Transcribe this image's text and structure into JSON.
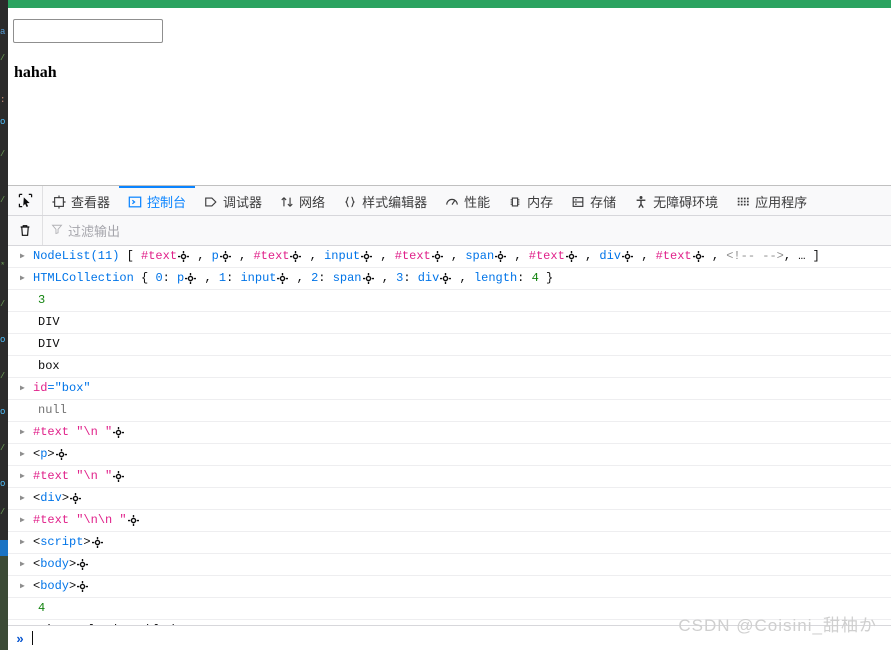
{
  "colors": {
    "accent": "#0a84ff",
    "green_bar": "#2ba360",
    "tag_blue": "#0074e8",
    "text_pink": "#e0218a",
    "number_green": "#12830f",
    "null_grey": "#737373",
    "watermark": "#cfcfcf"
  },
  "page": {
    "input_value": "",
    "input_placeholder": "",
    "body_text": "hahah"
  },
  "devtools": {
    "picker_icon": "element-picker-icon",
    "tabs": [
      {
        "label": "查看器",
        "icon": "inspector-icon",
        "active": false
      },
      {
        "label": "控制台",
        "icon": "console-icon",
        "active": true
      },
      {
        "label": "调试器",
        "icon": "debugger-icon",
        "active": false
      },
      {
        "label": "网络",
        "icon": "network-icon",
        "active": false
      },
      {
        "label": "样式编辑器",
        "icon": "style-editor-icon",
        "active": false
      },
      {
        "label": "性能",
        "icon": "performance-icon",
        "active": false
      },
      {
        "label": "内存",
        "icon": "memory-icon",
        "active": false
      },
      {
        "label": "存储",
        "icon": "storage-icon",
        "active": false
      },
      {
        "label": "无障碍环境",
        "icon": "accessibility-icon",
        "active": false
      },
      {
        "label": "应用程序",
        "icon": "application-icon",
        "active": false
      }
    ],
    "filter_bar": {
      "trash_icon": "trash-icon",
      "filter_icon": "funnel-icon",
      "placeholder": "过滤输出",
      "value": ""
    },
    "prompt": {
      "chevron": "»",
      "value": ""
    }
  },
  "console_rows": [
    {
      "id": "nodelist-row",
      "twisty": true,
      "segments": [
        {
          "t": "NodeList(11) ",
          "c": "k-blue"
        },
        {
          "t": "[ ",
          "c": "k-dark"
        },
        {
          "t": "#text",
          "c": "k-pink"
        },
        {
          "t": "crosshair",
          "c": "icon"
        },
        {
          "t": " , ",
          "c": "k-dark"
        },
        {
          "t": "p",
          "c": "k-blue"
        },
        {
          "t": "crosshair",
          "c": "icon"
        },
        {
          "t": " , ",
          "c": "k-dark"
        },
        {
          "t": "#text",
          "c": "k-pink"
        },
        {
          "t": "crosshair",
          "c": "icon"
        },
        {
          "t": " , ",
          "c": "k-dark"
        },
        {
          "t": "input",
          "c": "k-blue"
        },
        {
          "t": "crosshair",
          "c": "icon"
        },
        {
          "t": " , ",
          "c": "k-dark"
        },
        {
          "t": "#text",
          "c": "k-pink"
        },
        {
          "t": "crosshair",
          "c": "icon"
        },
        {
          "t": " , ",
          "c": "k-dark"
        },
        {
          "t": "span",
          "c": "k-blue"
        },
        {
          "t": "crosshair",
          "c": "icon"
        },
        {
          "t": " , ",
          "c": "k-dark"
        },
        {
          "t": "#text",
          "c": "k-pink"
        },
        {
          "t": "crosshair",
          "c": "icon"
        },
        {
          "t": " , ",
          "c": "k-dark"
        },
        {
          "t": "div",
          "c": "k-blue"
        },
        {
          "t": "crosshair",
          "c": "icon"
        },
        {
          "t": " , ",
          "c": "k-dark"
        },
        {
          "t": "#text",
          "c": "k-pink"
        },
        {
          "t": "crosshair",
          "c": "icon"
        },
        {
          "t": " , ",
          "c": "k-dark"
        },
        {
          "t": "<!--    -->",
          "c": "k-comment"
        },
        {
          "t": ", … ]",
          "c": "k-dark"
        }
      ]
    },
    {
      "id": "htmlcollection-row",
      "twisty": true,
      "segments": [
        {
          "t": "HTMLCollection ",
          "c": "k-blue"
        },
        {
          "t": "{ ",
          "c": "k-dark"
        },
        {
          "t": "0",
          "c": "k-blue"
        },
        {
          "t": ": ",
          "c": "k-dark"
        },
        {
          "t": "p",
          "c": "k-blue"
        },
        {
          "t": "crosshair",
          "c": "icon"
        },
        {
          "t": " , ",
          "c": "k-dark"
        },
        {
          "t": "1",
          "c": "k-blue"
        },
        {
          "t": ": ",
          "c": "k-dark"
        },
        {
          "t": "input",
          "c": "k-blue"
        },
        {
          "t": "crosshair",
          "c": "icon"
        },
        {
          "t": " , ",
          "c": "k-dark"
        },
        {
          "t": "2",
          "c": "k-blue"
        },
        {
          "t": ": ",
          "c": "k-dark"
        },
        {
          "t": "span",
          "c": "k-blue"
        },
        {
          "t": "crosshair",
          "c": "icon"
        },
        {
          "t": " , ",
          "c": "k-dark"
        },
        {
          "t": "3",
          "c": "k-blue"
        },
        {
          "t": ": ",
          "c": "k-dark"
        },
        {
          "t": "div",
          "c": "k-blue"
        },
        {
          "t": "crosshair",
          "c": "icon"
        },
        {
          "t": " , ",
          "c": "k-dark"
        },
        {
          "t": "length",
          "c": "k-blue"
        },
        {
          "t": ": ",
          "c": "k-dark"
        },
        {
          "t": "4",
          "c": "k-green"
        },
        {
          "t": " }",
          "c": "k-dark"
        }
      ]
    },
    {
      "id": "num-3-row",
      "twisty": false,
      "segments": [
        {
          "t": "3",
          "c": "k-green"
        }
      ]
    },
    {
      "id": "div-1-row",
      "twisty": false,
      "segments": [
        {
          "t": "DIV",
          "c": "k-dark"
        }
      ]
    },
    {
      "id": "div-2-row",
      "twisty": false,
      "segments": [
        {
          "t": "DIV",
          "c": "k-dark"
        }
      ]
    },
    {
      "id": "box-row",
      "twisty": false,
      "segments": [
        {
          "t": "box",
          "c": "k-dark"
        }
      ]
    },
    {
      "id": "idbox-row",
      "twisty": true,
      "segments": [
        {
          "t": "id",
          "c": "k-pink"
        },
        {
          "t": "=\"box\"",
          "c": "k-blue"
        }
      ]
    },
    {
      "id": "null-row",
      "twisty": false,
      "segments": [
        {
          "t": "null",
          "c": "k-grey"
        }
      ]
    },
    {
      "id": "text-node-1-row",
      "twisty": true,
      "segments": [
        {
          "t": "#text",
          "c": "k-pink"
        },
        {
          "t": " \"\\n           \"",
          "c": "k-pink"
        },
        {
          "t": "crosshair",
          "c": "icon"
        }
      ]
    },
    {
      "id": "p-node-row",
      "twisty": true,
      "segments": [
        {
          "t": "<",
          "c": "k-dark"
        },
        {
          "t": "p",
          "c": "k-blue"
        },
        {
          "t": ">",
          "c": "k-dark"
        },
        {
          "t": "crosshair",
          "c": "icon"
        }
      ]
    },
    {
      "id": "text-node-2-row",
      "twisty": true,
      "segments": [
        {
          "t": "#text",
          "c": "k-pink"
        },
        {
          "t": " \"\\n     \"",
          "c": "k-pink"
        },
        {
          "t": "crosshair",
          "c": "icon"
        }
      ]
    },
    {
      "id": "div-node-row",
      "twisty": true,
      "segments": [
        {
          "t": "<",
          "c": "k-dark"
        },
        {
          "t": "div",
          "c": "k-blue"
        },
        {
          "t": ">",
          "c": "k-dark"
        },
        {
          "t": "crosshair",
          "c": "icon"
        }
      ]
    },
    {
      "id": "text-node-3-row",
      "twisty": true,
      "segments": [
        {
          "t": "#text",
          "c": "k-pink"
        },
        {
          "t": " \"\\n\\n     \"",
          "c": "k-pink"
        },
        {
          "t": "crosshair",
          "c": "icon"
        }
      ]
    },
    {
      "id": "script-node-row",
      "twisty": true,
      "segments": [
        {
          "t": "<",
          "c": "k-dark"
        },
        {
          "t": "script",
          "c": "k-blue"
        },
        {
          "t": ">",
          "c": "k-dark"
        },
        {
          "t": "crosshair",
          "c": "icon"
        }
      ]
    },
    {
      "id": "body-node-1-row",
      "twisty": true,
      "segments": [
        {
          "t": "<",
          "c": "k-dark"
        },
        {
          "t": "body",
          "c": "k-blue"
        },
        {
          "t": ">",
          "c": "k-dark"
        },
        {
          "t": "crosshair",
          "c": "icon"
        }
      ]
    },
    {
      "id": "body-node-2-row",
      "twisty": true,
      "segments": [
        {
          "t": "<",
          "c": "k-dark"
        },
        {
          "t": "body",
          "c": "k-blue"
        },
        {
          "t": ">",
          "c": "k-dark"
        },
        {
          "t": "crosshair",
          "c": "icon"
        }
      ]
    },
    {
      "id": "num-4-row",
      "twisty": false,
      "segments": [
        {
          "t": "4",
          "c": "k-green"
        }
      ]
    },
    {
      "id": "live-reload-row",
      "twisty": false,
      "segments": [
        {
          "t": "Live reload enabled.",
          "c": "k-dark"
        }
      ]
    }
  ],
  "watermark": {
    "text": "CSDN @Coisini_甜柚か"
  }
}
